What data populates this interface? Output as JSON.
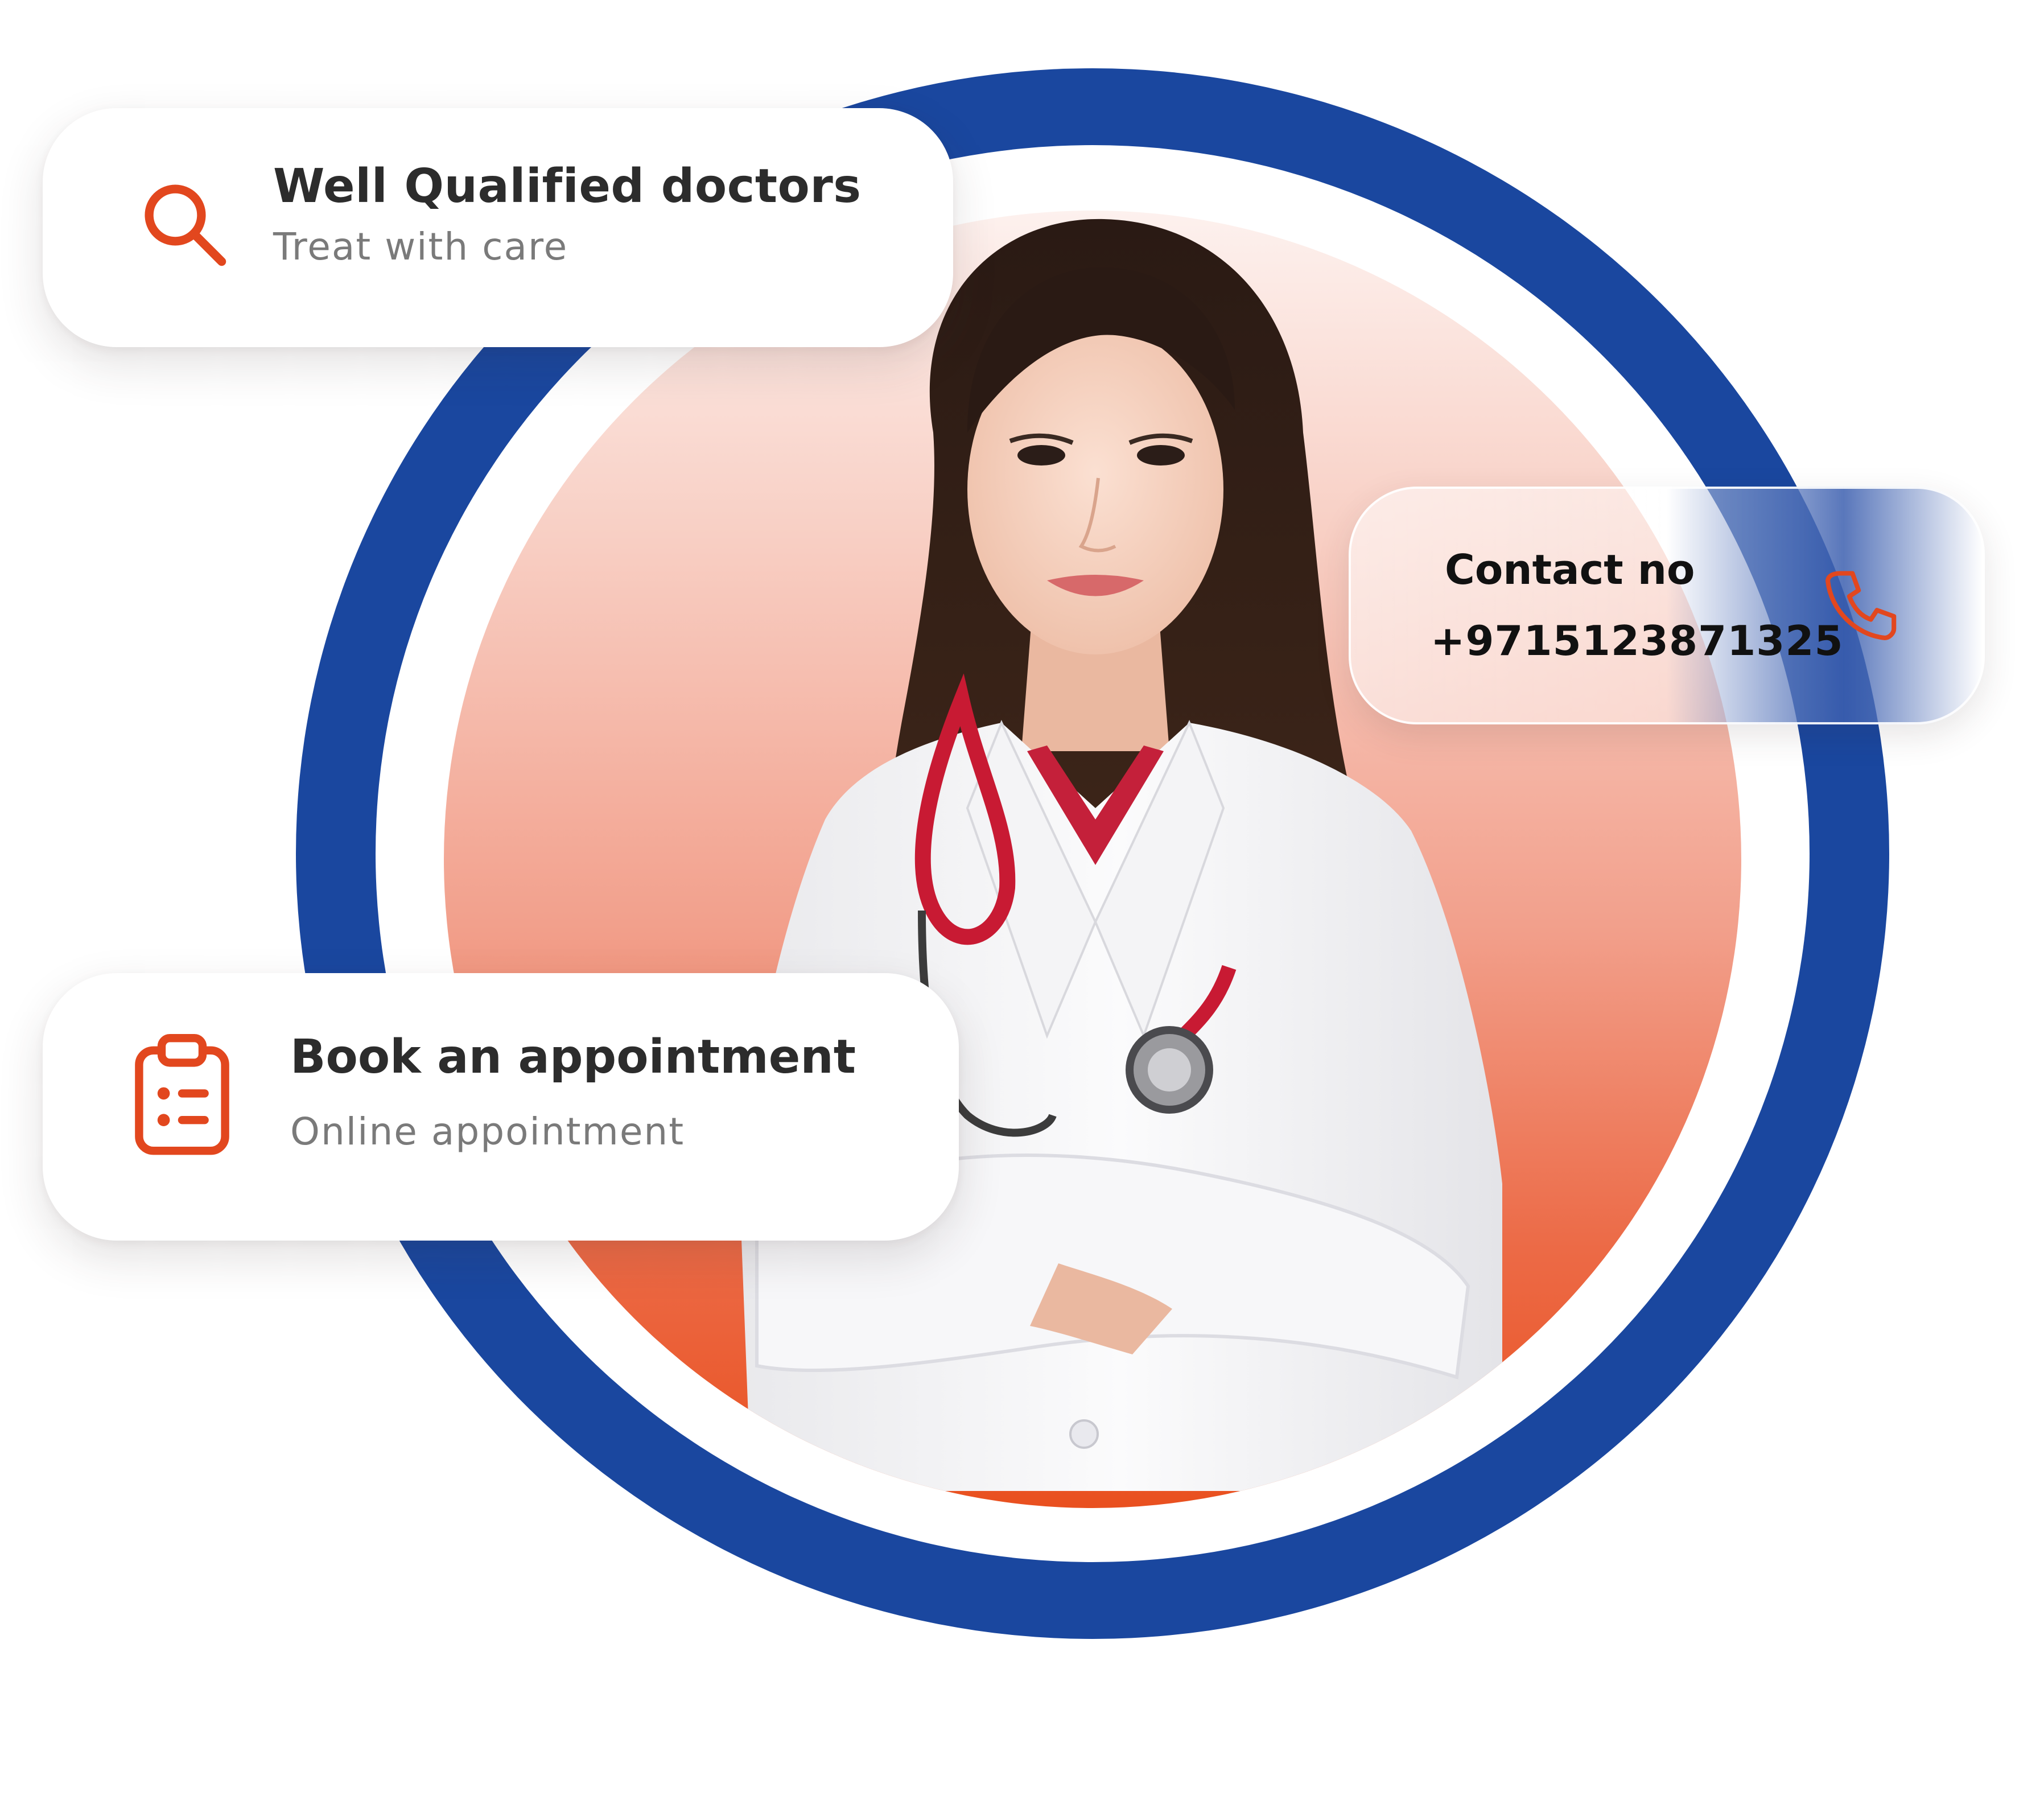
{
  "cards": {
    "doctors": {
      "title": "Well Qualified doctors",
      "subtitle": "Treat with care",
      "icon": "search-icon"
    },
    "contact": {
      "title": "Contact no",
      "phone": "+9715123871325",
      "icon": "phone-icon"
    },
    "appointment": {
      "title": "Book an appointment",
      "subtitle": "Online appointment",
      "icon": "clipboard-icon"
    }
  },
  "colors": {
    "ring": "#1a479f",
    "accent": "#e2471e",
    "gradient_top": "#fdf1ee",
    "gradient_bottom": "#e9501f"
  }
}
